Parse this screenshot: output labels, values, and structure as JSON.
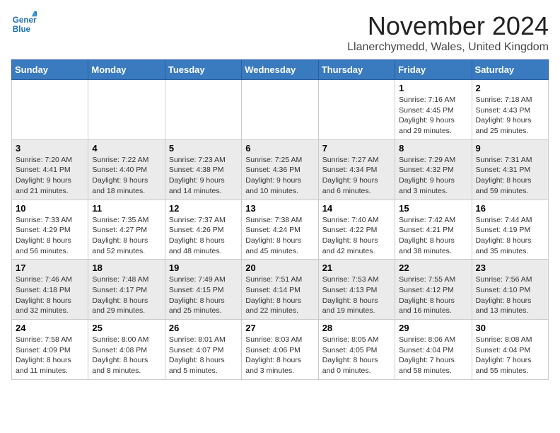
{
  "logo": {
    "line1": "General",
    "line2": "Blue"
  },
  "title": "November 2024",
  "location": "Llanerchymedd, Wales, United Kingdom",
  "weekdays": [
    "Sunday",
    "Monday",
    "Tuesday",
    "Wednesday",
    "Thursday",
    "Friday",
    "Saturday"
  ],
  "weeks": [
    [
      {
        "day": "",
        "info": ""
      },
      {
        "day": "",
        "info": ""
      },
      {
        "day": "",
        "info": ""
      },
      {
        "day": "",
        "info": ""
      },
      {
        "day": "",
        "info": ""
      },
      {
        "day": "1",
        "info": "Sunrise: 7:16 AM\nSunset: 4:45 PM\nDaylight: 9 hours and 29 minutes."
      },
      {
        "day": "2",
        "info": "Sunrise: 7:18 AM\nSunset: 4:43 PM\nDaylight: 9 hours and 25 minutes."
      }
    ],
    [
      {
        "day": "3",
        "info": "Sunrise: 7:20 AM\nSunset: 4:41 PM\nDaylight: 9 hours and 21 minutes."
      },
      {
        "day": "4",
        "info": "Sunrise: 7:22 AM\nSunset: 4:40 PM\nDaylight: 9 hours and 18 minutes."
      },
      {
        "day": "5",
        "info": "Sunrise: 7:23 AM\nSunset: 4:38 PM\nDaylight: 9 hours and 14 minutes."
      },
      {
        "day": "6",
        "info": "Sunrise: 7:25 AM\nSunset: 4:36 PM\nDaylight: 9 hours and 10 minutes."
      },
      {
        "day": "7",
        "info": "Sunrise: 7:27 AM\nSunset: 4:34 PM\nDaylight: 9 hours and 6 minutes."
      },
      {
        "day": "8",
        "info": "Sunrise: 7:29 AM\nSunset: 4:32 PM\nDaylight: 9 hours and 3 minutes."
      },
      {
        "day": "9",
        "info": "Sunrise: 7:31 AM\nSunset: 4:31 PM\nDaylight: 8 hours and 59 minutes."
      }
    ],
    [
      {
        "day": "10",
        "info": "Sunrise: 7:33 AM\nSunset: 4:29 PM\nDaylight: 8 hours and 56 minutes."
      },
      {
        "day": "11",
        "info": "Sunrise: 7:35 AM\nSunset: 4:27 PM\nDaylight: 8 hours and 52 minutes."
      },
      {
        "day": "12",
        "info": "Sunrise: 7:37 AM\nSunset: 4:26 PM\nDaylight: 8 hours and 48 minutes."
      },
      {
        "day": "13",
        "info": "Sunrise: 7:38 AM\nSunset: 4:24 PM\nDaylight: 8 hours and 45 minutes."
      },
      {
        "day": "14",
        "info": "Sunrise: 7:40 AM\nSunset: 4:22 PM\nDaylight: 8 hours and 42 minutes."
      },
      {
        "day": "15",
        "info": "Sunrise: 7:42 AM\nSunset: 4:21 PM\nDaylight: 8 hours and 38 minutes."
      },
      {
        "day": "16",
        "info": "Sunrise: 7:44 AM\nSunset: 4:19 PM\nDaylight: 8 hours and 35 minutes."
      }
    ],
    [
      {
        "day": "17",
        "info": "Sunrise: 7:46 AM\nSunset: 4:18 PM\nDaylight: 8 hours and 32 minutes."
      },
      {
        "day": "18",
        "info": "Sunrise: 7:48 AM\nSunset: 4:17 PM\nDaylight: 8 hours and 29 minutes."
      },
      {
        "day": "19",
        "info": "Sunrise: 7:49 AM\nSunset: 4:15 PM\nDaylight: 8 hours and 25 minutes."
      },
      {
        "day": "20",
        "info": "Sunrise: 7:51 AM\nSunset: 4:14 PM\nDaylight: 8 hours and 22 minutes."
      },
      {
        "day": "21",
        "info": "Sunrise: 7:53 AM\nSunset: 4:13 PM\nDaylight: 8 hours and 19 minutes."
      },
      {
        "day": "22",
        "info": "Sunrise: 7:55 AM\nSunset: 4:12 PM\nDaylight: 8 hours and 16 minutes."
      },
      {
        "day": "23",
        "info": "Sunrise: 7:56 AM\nSunset: 4:10 PM\nDaylight: 8 hours and 13 minutes."
      }
    ],
    [
      {
        "day": "24",
        "info": "Sunrise: 7:58 AM\nSunset: 4:09 PM\nDaylight: 8 hours and 11 minutes."
      },
      {
        "day": "25",
        "info": "Sunrise: 8:00 AM\nSunset: 4:08 PM\nDaylight: 8 hours and 8 minutes."
      },
      {
        "day": "26",
        "info": "Sunrise: 8:01 AM\nSunset: 4:07 PM\nDaylight: 8 hours and 5 minutes."
      },
      {
        "day": "27",
        "info": "Sunrise: 8:03 AM\nSunset: 4:06 PM\nDaylight: 8 hours and 3 minutes."
      },
      {
        "day": "28",
        "info": "Sunrise: 8:05 AM\nSunset: 4:05 PM\nDaylight: 8 hours and 0 minutes."
      },
      {
        "day": "29",
        "info": "Sunrise: 8:06 AM\nSunset: 4:04 PM\nDaylight: 7 hours and 58 minutes."
      },
      {
        "day": "30",
        "info": "Sunrise: 8:08 AM\nSunset: 4:04 PM\nDaylight: 7 hours and 55 minutes."
      }
    ]
  ]
}
